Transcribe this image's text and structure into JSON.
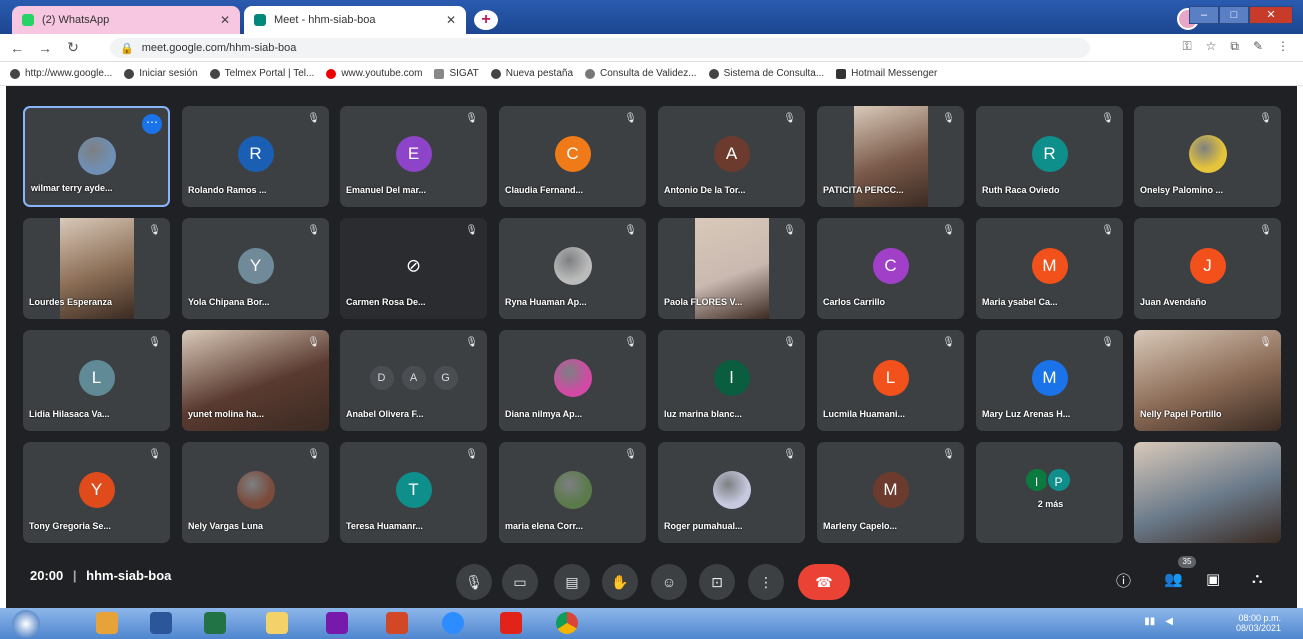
{
  "browser": {
    "tabs": [
      {
        "title": "(2) WhatsApp",
        "close": "✕"
      },
      {
        "title": "Meet - hhm-siab-boa",
        "close": "✕"
      }
    ],
    "new_tab": "+",
    "url": "meet.google.com/hhm-siab-boa",
    "bookmarks": [
      "http://www.google...",
      "Iniciar sesión",
      "Telmex Portal | Tel...",
      "www.youtube.com",
      "SIGAT",
      "Nueva pestaña",
      "Consulta de Validez...",
      "Sistema de Consulta...",
      "Hotmail Messenger"
    ]
  },
  "participants": [
    {
      "name": "wilmar terry ayde...",
      "type": "photo",
      "color": "#6f8fb5",
      "self": true
    },
    {
      "name": "Rolando Ramos ...",
      "type": "avatar",
      "initial": "R",
      "color": "#1a5fb4"
    },
    {
      "name": "Emanuel Del mar...",
      "type": "avatar",
      "initial": "E",
      "color": "#8e44c9"
    },
    {
      "name": "Claudia Fernand...",
      "type": "avatar",
      "initial": "C",
      "color": "#f07a18"
    },
    {
      "name": "Antonio De la Tor...",
      "type": "avatar",
      "initial": "A",
      "color": "#6d3b2e"
    },
    {
      "name": "PATICITA PERCC...",
      "type": "video",
      "color": "#7a5a4a"
    },
    {
      "name": "Ruth Raca Oviedo",
      "type": "avatar",
      "initial": "R",
      "color": "#0f8f8c"
    },
    {
      "name": "Onelsy Palomino ...",
      "type": "photo",
      "color": "#e5c43a"
    },
    {
      "name": "Lourdes Esperanza",
      "type": "video",
      "color": "#8a6d55"
    },
    {
      "name": "Yola Chipana Bor...",
      "type": "avatar",
      "initial": "Y",
      "color": "#708a99"
    },
    {
      "name": "Carmen Rosa De...",
      "type": "camoff"
    },
    {
      "name": "Ryna Huaman Ap...",
      "type": "photo",
      "color": "#bbbbbb"
    },
    {
      "name": "Paola FLORES V...",
      "type": "video",
      "color": "#c9b9b0"
    },
    {
      "name": "Carlos Carrillo",
      "type": "avatar",
      "initial": "C",
      "color": "#a23fc8"
    },
    {
      "name": "Maria ysabel Ca...",
      "type": "avatar",
      "initial": "M",
      "color": "#f2511b"
    },
    {
      "name": "Juan Avendaño",
      "type": "avatar",
      "initial": "J",
      "color": "#f2511b"
    },
    {
      "name": "Lidia Hilasaca Va...",
      "type": "avatar",
      "initial": "L",
      "color": "#5f8a96"
    },
    {
      "name": "yunet molina ha...",
      "type": "video",
      "color": "#5a3a30"
    },
    {
      "name": "Anabel Olivera F...",
      "type": "three"
    },
    {
      "name": "Diana nilmya Ap...",
      "type": "photo",
      "color": "#d24aa5"
    },
    {
      "name": "luz marina blanc...",
      "type": "avatar",
      "initial": "l",
      "color": "#0b5d3f"
    },
    {
      "name": "Lucmila Huamani...",
      "type": "avatar",
      "initial": "L",
      "color": "#f2511b"
    },
    {
      "name": "Mary Luz Arenas H...",
      "type": "avatar",
      "initial": "M",
      "color": "#1a73e8"
    },
    {
      "name": "Nelly Papel Portillo",
      "type": "video",
      "color": "#8a6a55"
    },
    {
      "name": "Tony Gregoria Se...",
      "type": "avatar",
      "initial": "Y",
      "color": "#e04b1c"
    },
    {
      "name": "Nely Vargas Luna",
      "type": "photo",
      "color": "#7a4a3a"
    },
    {
      "name": "Teresa Huamanr...",
      "type": "avatar",
      "initial": "T",
      "color": "#0f8f8c"
    },
    {
      "name": "maria elena Corr...",
      "type": "photo",
      "color": "#5a7a4a"
    },
    {
      "name": "Roger pumahual...",
      "type": "photo",
      "color": "#c7c9e0"
    },
    {
      "name": "Marleny Capelo...",
      "type": "avatar",
      "initial": "M",
      "color": "#6d3b2e"
    },
    {
      "name": "2 más",
      "type": "two",
      "initials": [
        "I",
        "P"
      ],
      "colors": [
        "#0b7a3f",
        "#0f8f8c"
      ]
    },
    {
      "name": "",
      "type": "video",
      "color": "#6a7a8a"
    }
  ],
  "three_initials": [
    "D",
    "A",
    "G"
  ],
  "meeting": {
    "time": "20:00",
    "separator": "|",
    "code": "hhm-siab-boa",
    "participant_badge": "35"
  },
  "taskbar": {
    "time": "08:00 p.m.",
    "date": "08/03/2021"
  }
}
